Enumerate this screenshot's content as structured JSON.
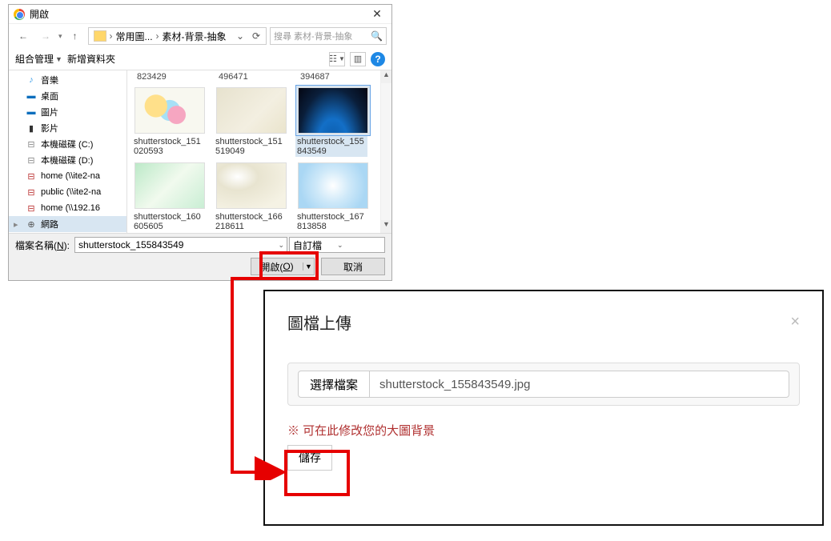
{
  "dialog": {
    "title": "開啟",
    "breadcrumb": {
      "p1": "常用圖...",
      "p2": "素材-背景-抽象"
    },
    "search_placeholder": "搜尋 素材-背景-抽象",
    "toolbar": {
      "organize": "組合管理",
      "new_folder": "新增資料夾"
    },
    "partial_row": [
      "823429",
      "496471",
      "394687"
    ],
    "files": [
      {
        "name": "shutterstock_151020593",
        "cls": "a"
      },
      {
        "name": "shutterstock_151519049",
        "cls": "b"
      },
      {
        "name": "shutterstock_155843549",
        "cls": "c",
        "selected": true
      },
      {
        "name": "shutterstock_160605605",
        "cls": "d"
      },
      {
        "name": "shutterstock_166218611",
        "cls": "e"
      },
      {
        "name": "shutterstock_167813858",
        "cls": "f"
      }
    ],
    "tree": [
      {
        "name": "音樂",
        "glyph": "♪",
        "gcls": "music"
      },
      {
        "name": "桌面",
        "glyph": "▬",
        "gcls": "desktop"
      },
      {
        "name": "圖片",
        "glyph": "▬",
        "gcls": "pictures"
      },
      {
        "name": "影片",
        "glyph": "▮",
        "gcls": "videos"
      },
      {
        "name": "本機磁碟 (C:)",
        "glyph": "⊟",
        "gcls": "disk"
      },
      {
        "name": "本機磁碟 (D:)",
        "glyph": "⊟",
        "gcls": "disk"
      },
      {
        "name": "home (\\\\ite2-na",
        "glyph": "⊟",
        "gcls": "net"
      },
      {
        "name": "public (\\\\ite2-na",
        "glyph": "⊟",
        "gcls": "net"
      },
      {
        "name": "home (\\\\192.16",
        "glyph": "⊟",
        "gcls": "net"
      },
      {
        "name": "網路",
        "glyph": "⊕",
        "gcls": "network",
        "selected": true,
        "arrow": "▸"
      }
    ],
    "filename_label_pre": "檔案名稱(",
    "filename_label_u": "N",
    "filename_label_post": "):",
    "filename_value": "shutterstock_155843549",
    "filter_label": "自訂檔",
    "open_pre": "開啟(",
    "open_u": "O",
    "open_post": ")",
    "cancel": "取消"
  },
  "modal": {
    "title": "圖檔上傳",
    "choose": "選擇檔案",
    "filename": "shutterstock_155843549.jpg",
    "note": "※ 可在此修改您的大圖背景",
    "save": "儲存"
  }
}
